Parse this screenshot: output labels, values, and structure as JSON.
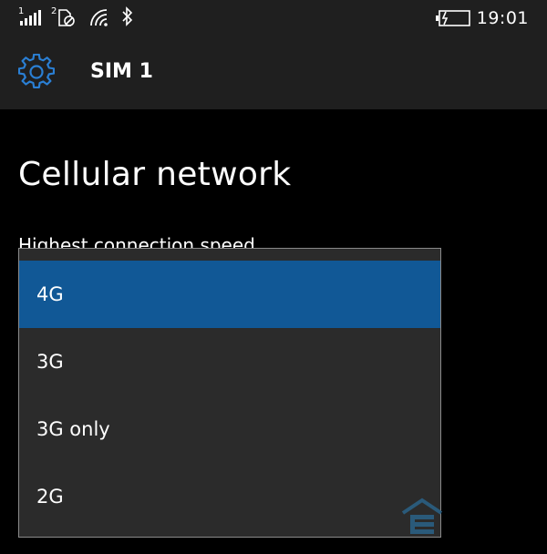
{
  "status_bar": {
    "sim1_indicator": "1",
    "sim2_indicator": "2",
    "time": "19:01",
    "icons": [
      "signal-bars-icon",
      "sim2-no-signal-icon",
      "wifi-icon",
      "bluetooth-icon",
      "battery-charging-icon"
    ]
  },
  "header": {
    "title": "SIM 1",
    "icon": "gear-icon"
  },
  "page": {
    "heading": "Cellular network",
    "field_label": "Highest connection speed"
  },
  "dropdown": {
    "options": [
      {
        "label": "4G",
        "selected": true
      },
      {
        "label": "3G",
        "selected": false
      },
      {
        "label": "3G only",
        "selected": false
      },
      {
        "label": "2G",
        "selected": false
      }
    ]
  },
  "colors": {
    "accent": "#115896",
    "header_bg": "#1f1f1f",
    "page_bg": "#000000",
    "popup_bg": "#2b2b2b",
    "gear_blue": "#2a7fd4"
  }
}
